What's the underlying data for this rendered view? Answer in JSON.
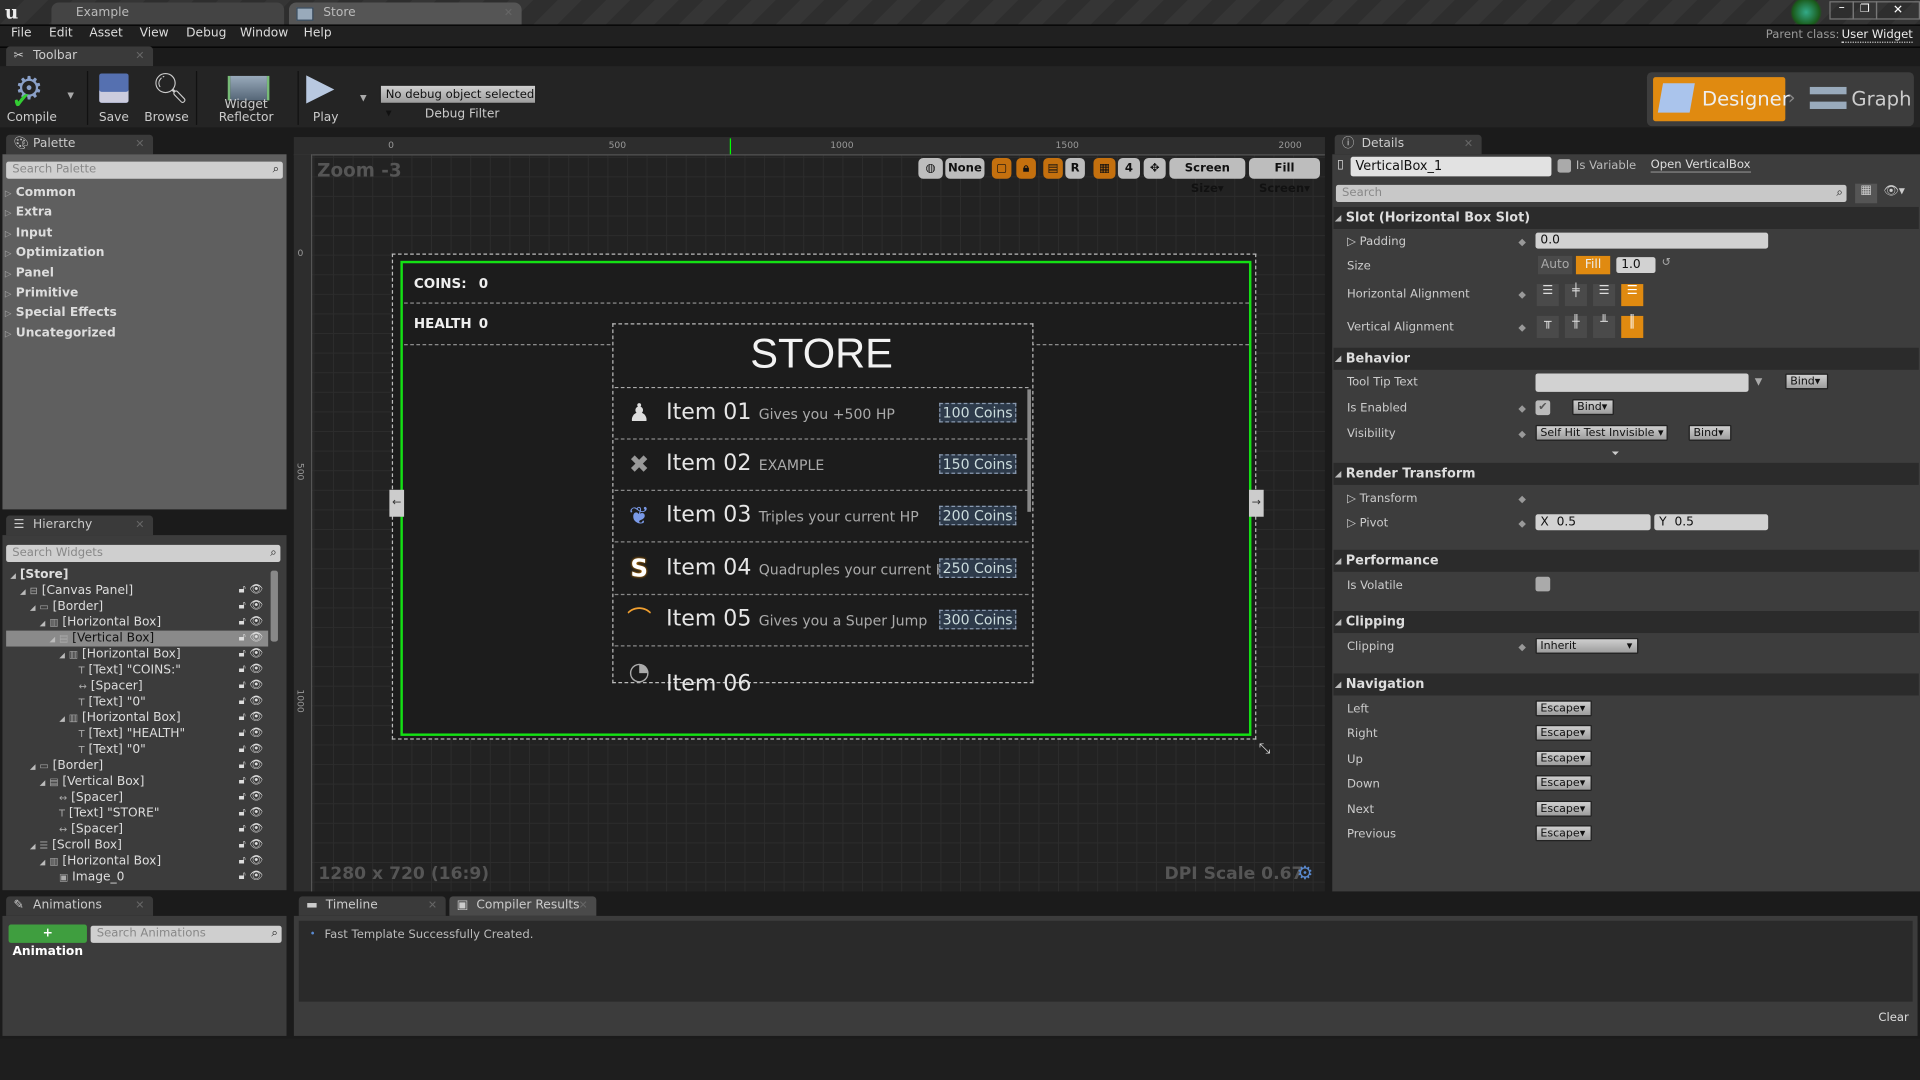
{
  "app": {
    "tabs": [
      "Example",
      "Store"
    ],
    "menu": [
      "File",
      "Edit",
      "Asset",
      "View",
      "Debug",
      "Window",
      "Help"
    ],
    "parent_class_label": "Parent class:",
    "parent_class_value": "User Widget"
  },
  "toolbar": {
    "tab": "Toolbar",
    "compile": "Compile",
    "save": "Save",
    "browse": "Browse",
    "reflector": "Widget Reflector",
    "play": "Play",
    "debug_select": "No debug object selected",
    "debug_filter": "Debug Filter"
  },
  "modes": {
    "designer": "Designer",
    "graph": "Graph"
  },
  "palette": {
    "tab": "Palette",
    "search_placeholder": "Search Palette",
    "categories": [
      "Common",
      "Extra",
      "Input",
      "Optimization",
      "Panel",
      "Primitive",
      "Special Effects",
      "Uncategorized"
    ]
  },
  "hierarchy": {
    "tab": "Hierarchy",
    "search_placeholder": "Search Widgets",
    "items": [
      {
        "label": "[Store]",
        "level": 0,
        "icon": "none"
      },
      {
        "label": "[Canvas Panel]",
        "level": 1,
        "icon": "canvas-icon"
      },
      {
        "label": "[Border]",
        "level": 2,
        "icon": "border-icon"
      },
      {
        "label": "[Horizontal Box]",
        "level": 3,
        "icon": "hbox-icon"
      },
      {
        "label": "[Vertical Box]",
        "level": 4,
        "icon": "vbox-icon",
        "selected": true
      },
      {
        "label": "[Horizontal Box]",
        "level": 5,
        "icon": "hbox-icon"
      },
      {
        "label": "[Text] \"COINS:\"",
        "level": 6,
        "icon": "text-icon"
      },
      {
        "label": "[Spacer]",
        "level": 6,
        "icon": "spacer-icon"
      },
      {
        "label": "[Text] \"0\"",
        "level": 6,
        "icon": "text-icon"
      },
      {
        "label": "[Horizontal Box]",
        "level": 5,
        "icon": "hbox-icon"
      },
      {
        "label": "[Text] \"HEALTH\"",
        "level": 6,
        "icon": "text-icon"
      },
      {
        "label": "[Text] \"0\"",
        "level": 6,
        "icon": "text-icon"
      },
      {
        "label": "[Border]",
        "level": 2,
        "icon": "border-icon"
      },
      {
        "label": "[Vertical Box]",
        "level": 3,
        "icon": "vbox-icon"
      },
      {
        "label": "[Spacer]",
        "level": 4,
        "icon": "spacer-icon"
      },
      {
        "label": "[Text] \"STORE\"",
        "level": 4,
        "icon": "text-icon"
      },
      {
        "label": "[Spacer]",
        "level": 4,
        "icon": "spacer-icon"
      },
      {
        "label": "[Scroll Box]",
        "level": 2,
        "icon": "scrollbox-icon"
      },
      {
        "label": "[Horizontal Box]",
        "level": 3,
        "icon": "hbox-icon"
      },
      {
        "label": "Image_0",
        "level": 4,
        "icon": "image-icon"
      }
    ]
  },
  "viewport": {
    "zoom": "Zoom -3",
    "ruler": [
      "0",
      "500",
      "1000",
      "1500",
      "2000"
    ],
    "ruler_left": [
      "0",
      "500",
      "1000"
    ],
    "none_btn": "None",
    "r_btn": "R",
    "grid_num": "4",
    "screen_size": "Screen Size",
    "fill_screen": "Fill Screen",
    "resolution": "1280 x 720 (16:9)",
    "dpi": "DPI Scale 0.67"
  },
  "widget": {
    "coins_label": "COINS:",
    "coins_value": "0",
    "health_label": "HEALTH",
    "health_value": "0",
    "store_title": "STORE",
    "items": [
      {
        "name": "Item 01",
        "desc": "Gives you +500 HP",
        "price": "100 Coins",
        "icon": "potion-icon"
      },
      {
        "name": "Item 02",
        "desc": "EXAMPLE",
        "price": "150 Coins",
        "icon": "crossed-bones-icon"
      },
      {
        "name": "Item 03",
        "desc": "Triples your current HP",
        "price": "200 Coins",
        "icon": "leaf-icon"
      },
      {
        "name": "Item 04",
        "desc": "Quadruples your current HP",
        "price": "250 Coins",
        "icon": "s-rune-icon"
      },
      {
        "name": "Item 05",
        "desc": "Gives you a Super Jump",
        "price": "300 Coins",
        "icon": "jump-arc-icon"
      },
      {
        "name": "Item 06",
        "desc": "",
        "price": "",
        "icon": "compass-icon"
      }
    ]
  },
  "details": {
    "tab": "Details",
    "name_value": "VerticalBox_1",
    "is_variable": "Is Variable",
    "open_link": "Open VerticalBox",
    "search_placeholder": "Search",
    "slot": {
      "header": "Slot (Horizontal Box Slot)",
      "padding_label": "Padding",
      "padding_value": "0.0",
      "size_label": "Size",
      "size_auto": "Auto",
      "size_fill": "Fill",
      "size_value": "1.0",
      "halign_label": "Horizontal Alignment",
      "valign_label": "Vertical Alignment"
    },
    "behavior": {
      "header": "Behavior",
      "tooltip_label": "Tool Tip Text",
      "tooltip_value": "",
      "enabled_label": "Is Enabled",
      "enabled": true,
      "visibility_label": "Visibility",
      "visibility_value": "Self Hit Test Invisible",
      "bind": "Bind"
    },
    "render": {
      "header": "Render Transform",
      "transform_label": "Transform",
      "pivot_label": "Pivot",
      "pivot_x": "0.5",
      "pivot_y": "0.5",
      "x": "X",
      "y": "Y"
    },
    "performance": {
      "header": "Performance",
      "volatile_label": "Is Volatile",
      "volatile": false
    },
    "clipping": {
      "header": "Clipping",
      "label": "Clipping",
      "value": "Inherit"
    },
    "navigation": {
      "header": "Navigation",
      "rows": [
        {
          "label": "Left",
          "value": "Escape"
        },
        {
          "label": "Right",
          "value": "Escape"
        },
        {
          "label": "Up",
          "value": "Escape"
        },
        {
          "label": "Down",
          "value": "Escape"
        },
        {
          "label": "Next",
          "value": "Escape"
        },
        {
          "label": "Previous",
          "value": "Escape"
        }
      ]
    }
  },
  "animations": {
    "tab": "Animations",
    "add": "+ Animation",
    "search_placeholder": "Search Animations"
  },
  "bottom": {
    "tabs": [
      "Timeline",
      "Compiler Results"
    ],
    "message": "Fast Template Successfully Created.",
    "clear": "Clear"
  },
  "colors": {
    "accent": "#e08a10",
    "selection": "#00ff00",
    "add_green": "#3f9e3f"
  }
}
